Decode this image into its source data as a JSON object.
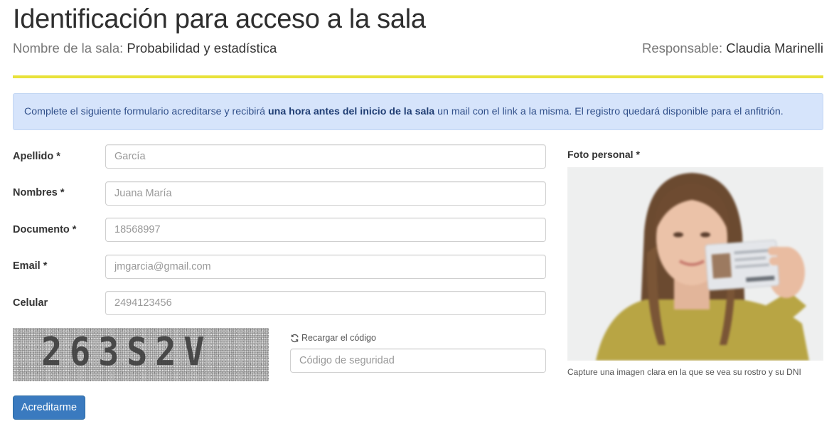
{
  "header": {
    "title": "Identificación para acceso a la sala",
    "room_label": "Nombre de la sala:",
    "room_value": "Probabilidad y estadística",
    "responsible_label": "Responsable:",
    "responsible_value": "Claudia Marinelli"
  },
  "notice": {
    "text_before": "Complete el siguiente formulario acreditarse y recibirá ",
    "text_bold": "una hora antes del inicio de la sala",
    "text_after": " un mail con el link a la misma. El registro quedará disponible para el anfitrión."
  },
  "form": {
    "fields": [
      {
        "label": "Apellido *",
        "placeholder": "García",
        "value": ""
      },
      {
        "label": "Nombres *",
        "placeholder": "Juana María",
        "value": ""
      },
      {
        "label": "Documento *",
        "placeholder": "18568997",
        "value": ""
      },
      {
        "label": "Email *",
        "placeholder": "jmgarcia@gmail.com",
        "value": ""
      },
      {
        "label": "Celular",
        "placeholder": "2494123456",
        "value": ""
      }
    ],
    "captcha_text": "263S2V",
    "reload_label": "Recargar el código",
    "reload_icon": "refresh-icon",
    "security_placeholder": "Código de seguridad",
    "submit_label": "Acreditarme"
  },
  "photo": {
    "label": "Foto personal *",
    "help": "Capture una imagen clara en la que se vea su rostro y su DNI"
  },
  "colors": {
    "accent_rule": "#e8e23a",
    "notice_bg": "#d6e4fb",
    "primary_button": "#3a7abf"
  }
}
